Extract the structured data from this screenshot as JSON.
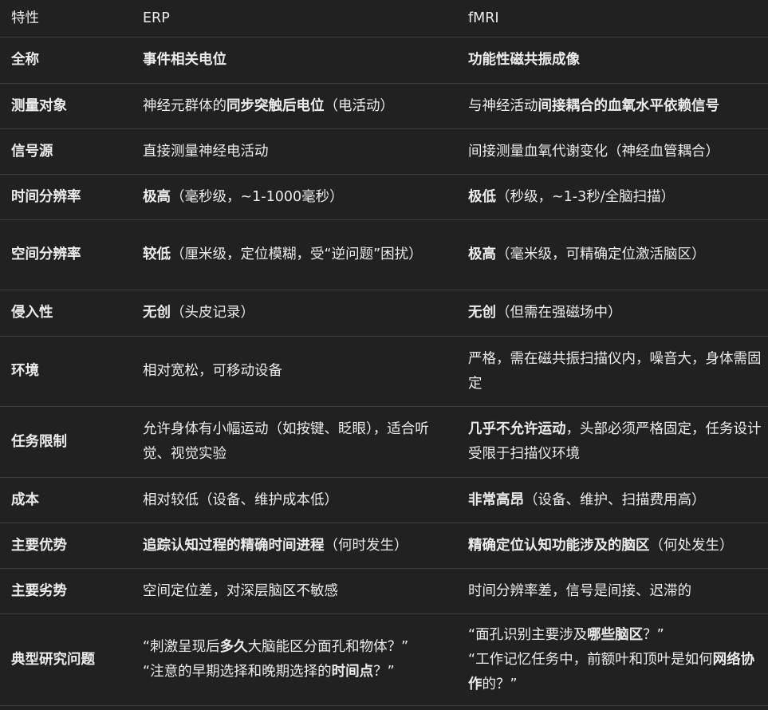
{
  "header": {
    "feature": "特性",
    "erp": "ERP",
    "fmri": "fMRI"
  },
  "rows": [
    {
      "feature": "全称",
      "erp": [
        {
          "t": "事件相关电位",
          "b": true
        }
      ],
      "fmri": [
        {
          "t": "功能性磁共振成像",
          "b": true
        }
      ]
    },
    {
      "feature": "测量对象",
      "erp": [
        {
          "t": "神经元群体的",
          "b": false
        },
        {
          "t": "同步突触后电位",
          "b": true
        },
        {
          "t": "（电活动）",
          "b": false
        }
      ],
      "fmri": [
        {
          "t": "与神经活动",
          "b": false
        },
        {
          "t": "间接耦合的血氧水平依赖信号",
          "b": true
        }
      ]
    },
    {
      "feature": "信号源",
      "erp": [
        {
          "t": "直接测量神经电活动",
          "b": false
        }
      ],
      "fmri": [
        {
          "t": "间接测量血氧代谢变化（神经血管耦合）",
          "b": false
        }
      ]
    },
    {
      "feature": "时间分辨率",
      "erp": [
        {
          "t": "极高",
          "b": true
        },
        {
          "t": "（毫秒级，~1-1000毫秒）",
          "b": false
        }
      ],
      "fmri": [
        {
          "t": "极低",
          "b": true
        },
        {
          "t": "（秒级，~1-3秒/全脑扫描）",
          "b": false
        }
      ]
    },
    {
      "feature": "空间分辨率",
      "erp": [
        {
          "t": "较低",
          "b": true
        },
        {
          "t": "（厘米级，定位模糊，受“逆问题”困扰）",
          "b": false
        }
      ],
      "fmri": [
        {
          "t": "极高",
          "b": true
        },
        {
          "t": "（毫米级，可精确定位激活脑区）",
          "b": false
        }
      ]
    },
    {
      "feature": "侵入性",
      "erp": [
        {
          "t": "无创",
          "b": true
        },
        {
          "t": "（头皮记录）",
          "b": false
        }
      ],
      "fmri": [
        {
          "t": "无创",
          "b": true
        },
        {
          "t": "（但需在强磁场中）",
          "b": false
        }
      ]
    },
    {
      "feature": "环境",
      "erp": [
        {
          "t": "相对宽松，可移动设备",
          "b": false
        }
      ],
      "fmri": [
        {
          "t": "严格，需在磁共振扫描仪内，噪音大，身体需固定",
          "b": false
        }
      ]
    },
    {
      "feature": "任务限制",
      "erp": [
        {
          "t": "允许身体有小幅运动（如按键、眨眼），适合听觉、视觉实验",
          "b": false
        }
      ],
      "fmri": [
        {
          "t": "几乎不允许运动",
          "b": true
        },
        {
          "t": "，头部必须严格固定，任务设计受限于扫描仪环境",
          "b": false
        }
      ]
    },
    {
      "feature": "成本",
      "erp": [
        {
          "t": "相对较低（设备、维护成本低）",
          "b": false
        }
      ],
      "fmri": [
        {
          "t": "非常高昂",
          "b": true
        },
        {
          "t": "（设备、维护、扫描费用高）",
          "b": false
        }
      ]
    },
    {
      "feature": "主要优势",
      "erp": [
        {
          "t": "追踪认知过程的精确时间进程",
          "b": true
        },
        {
          "t": "（何时发生）",
          "b": false
        }
      ],
      "fmri": [
        {
          "t": "精确定位认知功能涉及的脑区",
          "b": true
        },
        {
          "t": "（何处发生）",
          "b": false
        }
      ]
    },
    {
      "feature": "主要劣势",
      "erp": [
        {
          "t": "空间定位差，对深层脑区不敏感",
          "b": false
        }
      ],
      "fmri": [
        {
          "t": "时间分辨率差，信号是间接、迟滞的",
          "b": false
        }
      ]
    },
    {
      "feature": "典型研究问题",
      "erp_lines": [
        [
          {
            "t": "“刺激呈现后",
            "b": false
          },
          {
            "t": "多久",
            "b": true
          },
          {
            "t": "大脑能区分面孔和物体？”",
            "b": false
          }
        ],
        [
          {
            "t": "“注意的早期选择和晚期选择的",
            "b": false
          },
          {
            "t": "时间点",
            "b": true
          },
          {
            "t": "？”",
            "b": false
          }
        ]
      ],
      "fmri_lines": [
        [
          {
            "t": "“面孔识别主要涉及",
            "b": false
          },
          {
            "t": "哪些脑区",
            "b": true
          },
          {
            "t": "？”",
            "b": false
          }
        ],
        [
          {
            "t": "“工作记忆任务中，前额叶和顶叶是如何",
            "b": false
          },
          {
            "t": "网络协作",
            "b": true
          },
          {
            "t": "的？”",
            "b": false
          }
        ]
      ]
    }
  ]
}
